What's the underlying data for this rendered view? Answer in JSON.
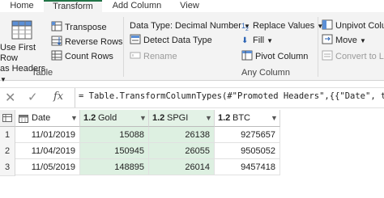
{
  "tabs": [
    "Home",
    "Transform",
    "Add Column",
    "View"
  ],
  "ribbon": {
    "table_group": {
      "use_first_row_line1": "Use First Row",
      "use_first_row_line2": "as Headers",
      "transpose": "Transpose",
      "reverse_rows": "Reverse Rows",
      "count_rows": "Count Rows",
      "label": "Table"
    },
    "any_column_group": {
      "data_type": "Data Type: Decimal Number",
      "detect_data_type": "Detect Data Type",
      "rename": "Rename",
      "replace_values": "Replace Values",
      "fill": "Fill",
      "pivot_column": "Pivot Column",
      "label": "Any Column"
    },
    "third_group": {
      "unpivot": "Unpivot Colu",
      "move": "Move",
      "convert": "Convert to Lis"
    }
  },
  "formula_bar": {
    "fx": "fx",
    "formula": "= Table.TransformColumnTypes(#\"Promoted Headers\",{{\"Date\", type"
  },
  "table": {
    "columns": [
      {
        "type": "date",
        "name": "Date"
      },
      {
        "type": "1.2",
        "name": "Gold"
      },
      {
        "type": "1.2",
        "name": "SPGI"
      },
      {
        "type": "1.2",
        "name": "BTC"
      }
    ],
    "rows": [
      {
        "num": "1",
        "Date": "11/01/2019",
        "Gold": "15088",
        "SPGI": "26138",
        "BTC": "9275657"
      },
      {
        "num": "2",
        "Date": "11/04/2019",
        "Gold": "150945",
        "SPGI": "26055",
        "BTC": "9505052"
      },
      {
        "num": "3",
        "Date": "11/05/2019",
        "Gold": "148895",
        "SPGI": "26014",
        "BTC": "9457418"
      }
    ]
  }
}
